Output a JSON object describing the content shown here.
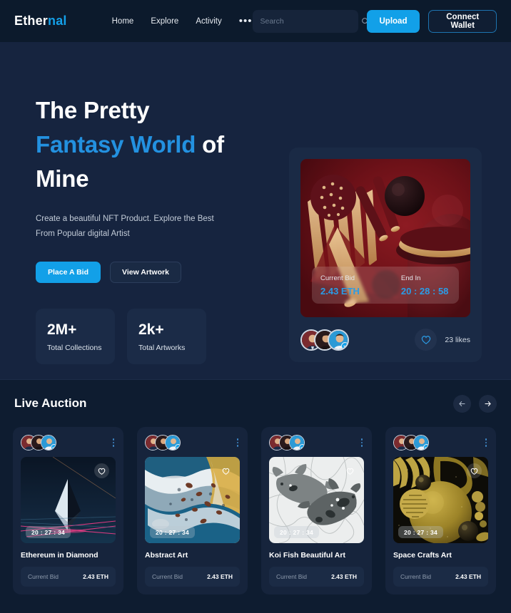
{
  "brand": {
    "name_primary": "Ether",
    "name_accent": "nal"
  },
  "nav": {
    "links": [
      {
        "label": "Home"
      },
      {
        "label": "Explore"
      },
      {
        "label": "Activity"
      }
    ],
    "more_label": "•••",
    "search": {
      "placeholder": "Search",
      "value": "",
      "icon": "search-icon"
    },
    "upload_label": "Upload",
    "wallet_label": "Connect Wallet"
  },
  "hero": {
    "title_line1": "The Pretty",
    "title_line2_blue": "Fantasy World",
    "title_line2_rest": " of",
    "title_line3": "Mine",
    "subtitle_line1": "Create a beautiful NFT Product. Explore the Best",
    "subtitle_line2": "From Popular digital Artist",
    "primary_cta": "Place A Bid",
    "secondary_cta": "View Artwork",
    "stats": [
      {
        "value": "2M+",
        "label": "Total Collections"
      },
      {
        "value": "2k+",
        "label": "Total Artworks"
      }
    ],
    "card": {
      "current_bid_label": "Current Bid",
      "current_bid_value": "2.43 ETH",
      "end_in_label": "End In",
      "end_in_value": "20 : 28 : 58",
      "likes_text": "23 likes",
      "heart_icon": "heart-icon",
      "verified_icon": "verified-check-icon"
    }
  },
  "auction": {
    "title": "Live Auction",
    "prev_icon": "arrow-left-icon",
    "next_icon": "arrow-right-icon",
    "bid_label": "Current Bid",
    "cards": [
      {
        "name": "Ethereum in Diamond",
        "timer": "20 : 27 : 34",
        "bid": "2.43 ETH",
        "liked": true
      },
      {
        "name": "Abstract Art",
        "timer": "20 : 27 : 34",
        "bid": "2.43 ETH",
        "liked": false
      },
      {
        "name": "Koi Fish Beautiful Art",
        "timer": "20 : 27 : 34",
        "bid": "2.43 ETH",
        "liked": false
      },
      {
        "name": "Space Crafts Art",
        "timer": "20 : 27 : 34",
        "bid": "2.43 ETH",
        "liked": true
      }
    ]
  },
  "colors": {
    "accent": "#12a0e8",
    "hero_bg": "#16243f",
    "nav_bg": "#0c1a2c",
    "auction_bg": "#0e1c30",
    "card_bg": "#16243c"
  }
}
